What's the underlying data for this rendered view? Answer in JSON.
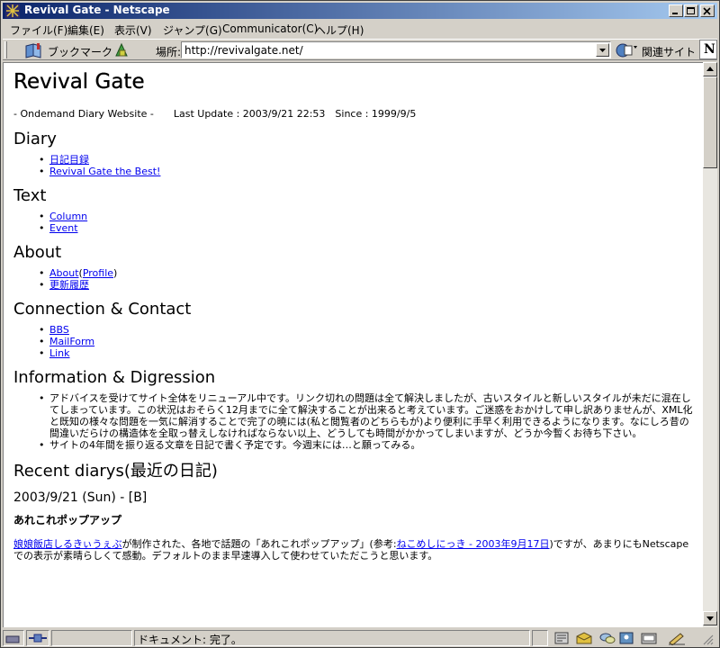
{
  "window": {
    "title": "Revival Gate - Netscape",
    "accent": "#0a246a"
  },
  "menu": {
    "items": [
      "ファイル(F)",
      "編集(E)",
      "表示(V)",
      "ジャンプ(G)",
      "Communicator(C)",
      "ヘルプ(H)"
    ]
  },
  "location": {
    "bookmark_label": "ブックマーク",
    "location_label": "場所:",
    "url": "http://revivalgate.net/",
    "related_label": "関連サイト",
    "logo": "N"
  },
  "page": {
    "title": "Revival Gate",
    "subtitle": "- Ondemand Diary Website -　　Last Update : 2003/9/21 22:53　Since : 1999/9/5",
    "sections": [
      {
        "heading": "Diary",
        "links": [
          "日記目録",
          "Revival Gate the Best!"
        ]
      },
      {
        "heading": "Text",
        "links": [
          "Column",
          "Event"
        ]
      },
      {
        "heading": "About",
        "links": [
          "About",
          "Profile",
          "更新履歴"
        ]
      },
      {
        "heading": "Connection & Contact",
        "links": [
          "BBS",
          "MailForm",
          "Link"
        ]
      }
    ],
    "info_heading": "Information & Digression",
    "info_items": [
      "アドバイスを受けてサイト全体をリニューアル中です。リンク切れの問題は全て解決しましたが、古いスタイルと新しいスタイルが未だに混在してしまっています。この状況はおそらく12月までに全て解決することが出来ると考えています。ご迷惑をおかけして申し訳ありませんが、XML化と既知の様々な問題を一気に解消することで完了の暁には(私と閲覧者のどちらもが)より便利に手早く利用できるようになります。なにしろ昔の間違いだらけの構造体を全取っ替えしなければならない以上、どうしても時間がかかってしまいますが、どうか今暫くお待ち下さい。",
      "サイトの4年間を振り返る文章を日記で書く予定です。今週末には…と願ってみる。"
    ],
    "recent_heading": "Recent diarys(最近の日記)",
    "diary_date": "2003/9/21 (Sun) - [B]",
    "entry_title": "あれこれポップアップ",
    "entry_link1": "娘娘飯店しるきぃうぇぶ",
    "entry_text1": "が制作された、各地で話題の「あれこれポップアップ」(参考:",
    "entry_link2": "ねこめしにっき - 2003年9月17日",
    "entry_text2": ")ですが、あまりにもNetscapeでの表示が素晴らしくて感動。デフォルトのまま早速導入して使わせていただこうと思います。"
  },
  "status": {
    "text": "ドキュメント: 完了。"
  }
}
